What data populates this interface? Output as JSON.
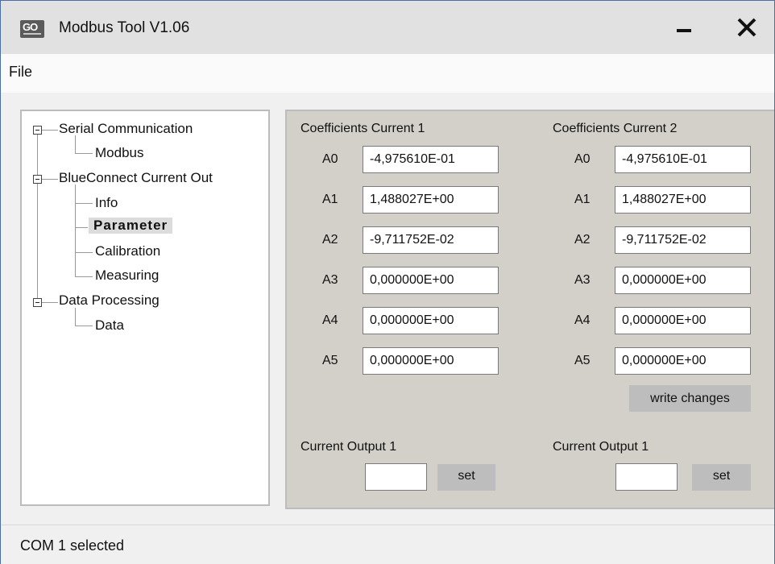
{
  "app": {
    "title": "Modbus Tool V1.06",
    "logo_text": "GO"
  },
  "menu": {
    "file": "File"
  },
  "tree": {
    "items": [
      {
        "label": "Serial Communication"
      },
      {
        "label": "Modbus"
      },
      {
        "label": "BlueConnect Current Out"
      },
      {
        "label": "Info"
      },
      {
        "label": "Parameter"
      },
      {
        "label": "Calibration"
      },
      {
        "label": "Measuring"
      },
      {
        "label": "Data Processing"
      },
      {
        "label": "Data"
      }
    ]
  },
  "panel": {
    "left": {
      "header": "Coefficients Current 1",
      "rows": [
        {
          "label": "A0",
          "value": "-4,975610E-01"
        },
        {
          "label": "A1",
          "value": "1,488027E+00"
        },
        {
          "label": "A2",
          "value": "-9,711752E-02"
        },
        {
          "label": "A3",
          "value": "0,000000E+00"
        },
        {
          "label": "A4",
          "value": "0,000000E+00"
        },
        {
          "label": "A5",
          "value": "0,000000E+00"
        }
      ],
      "output_label": "Current Output 1",
      "set_label": "set"
    },
    "right": {
      "header": "Coefficients Current 2",
      "rows": [
        {
          "label": "A0",
          "value": "-4,975610E-01"
        },
        {
          "label": "A1",
          "value": "1,488027E+00"
        },
        {
          "label": "A2",
          "value": "-9,711752E-02"
        },
        {
          "label": "A3",
          "value": "0,000000E+00"
        },
        {
          "label": "A4",
          "value": "0,000000E+00"
        },
        {
          "label": "A5",
          "value": "0,000000E+00"
        }
      ],
      "write_label": "write changes",
      "output_label": "Current Output 1",
      "set_label": "set"
    }
  },
  "status": {
    "text": "COM 1 selected"
  }
}
